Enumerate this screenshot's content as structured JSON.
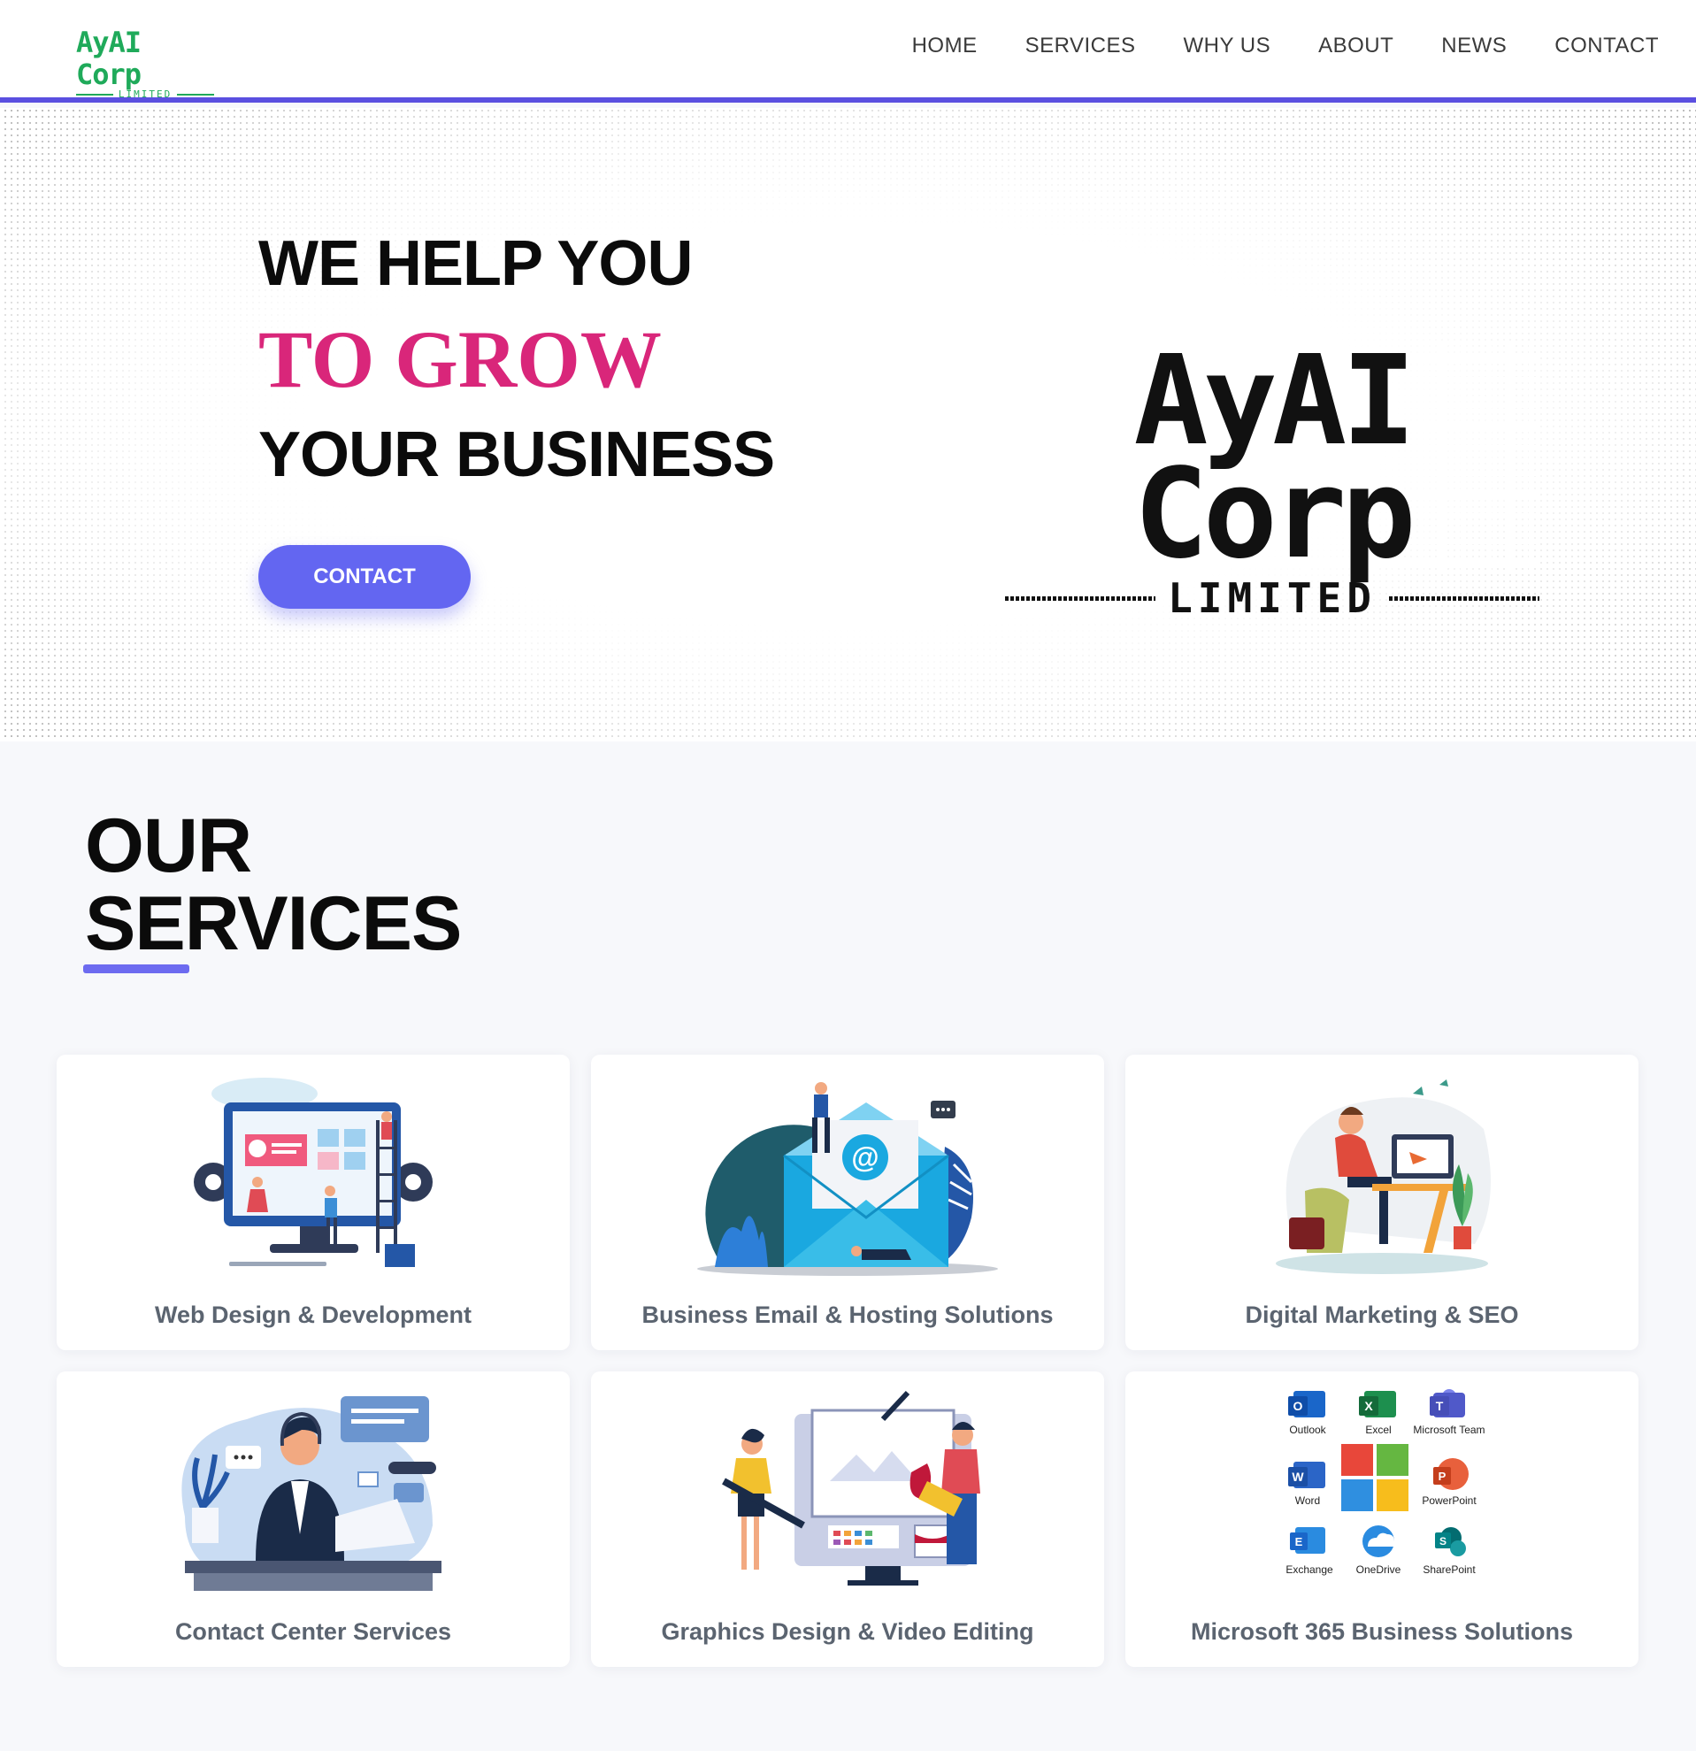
{
  "header": {
    "brand": {
      "name": "AyAI Corp",
      "sub": "LIMITED"
    },
    "nav": [
      "HOME",
      "SERVICES",
      "WHY US",
      "ABOUT",
      "NEWS",
      "CONTACT"
    ]
  },
  "hero": {
    "line1": "WE HELP YOU",
    "line2": "TO GROW",
    "line3": "YOUR BUSINESS",
    "button": "CONTACT",
    "logo": {
      "name": "AyAI Corp",
      "sub": "LIMITED"
    }
  },
  "services": {
    "title_line1": "OUR",
    "title_line2": "SERVICES",
    "cards": [
      {
        "label": "Web Design & Development"
      },
      {
        "label": "Business Email & Hosting Solutions"
      },
      {
        "label": "Digital Marketing & SEO"
      },
      {
        "label": "Contact Center Services"
      },
      {
        "label": "Graphics Design & Video Editing"
      },
      {
        "label": "Microsoft 365 Business Solutions"
      }
    ],
    "m365_apps": [
      "Outlook",
      "Excel",
      "Microsoft Team",
      "Word",
      "PowerPoint",
      "Exchange",
      "OneDrive",
      "SharePoint"
    ]
  },
  "colors": {
    "accent": "#6366f1",
    "header_border": "#5a4fe0",
    "grow": "#d9267a",
    "brand_green": "#1faa5a",
    "card_label": "#5b6470"
  }
}
